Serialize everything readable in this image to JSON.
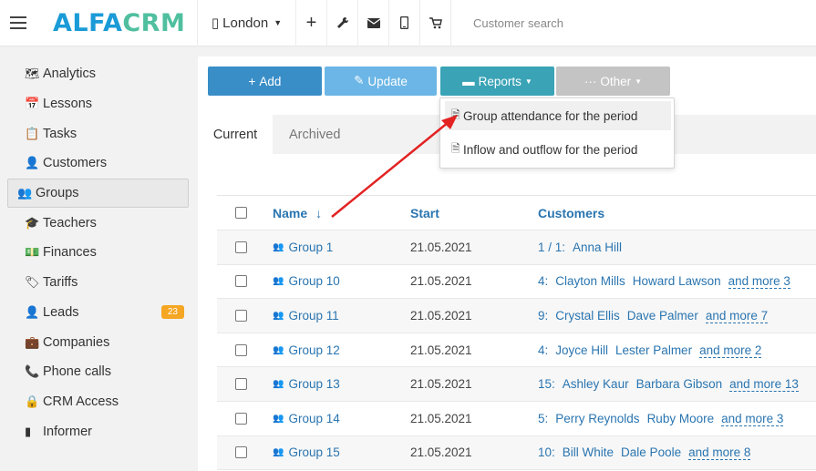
{
  "header": {
    "logo_part1": "ALFA",
    "logo_part2": "CRM",
    "city": "London",
    "search_placeholder": "Customer search",
    "icons": [
      "menu-icon",
      "tablet-icon",
      "plus-icon",
      "wrench-icon",
      "envelope-icon",
      "mobile-icon",
      "cart-icon"
    ]
  },
  "sidebar": {
    "items": [
      {
        "label": "Analytics",
        "icon": "map-icon",
        "glyph": "🗺"
      },
      {
        "label": "Lessons",
        "icon": "calendar-icon",
        "glyph": "📅"
      },
      {
        "label": "Tasks",
        "icon": "clipboard-icon",
        "glyph": "📋"
      },
      {
        "label": "Customers",
        "icon": "user-icon",
        "glyph": "👤"
      },
      {
        "label": "Groups",
        "icon": "users-icon",
        "glyph": "👥"
      },
      {
        "label": "Teachers",
        "icon": "graduation-cap-icon",
        "glyph": "🎓"
      },
      {
        "label": "Finances",
        "icon": "money-icon",
        "glyph": "💵"
      },
      {
        "label": "Tariffs",
        "icon": "tag-icon",
        "glyph": "🏷"
      },
      {
        "label": "Leads",
        "icon": "user-plus-icon",
        "glyph": "👤",
        "badge": "23"
      },
      {
        "label": "Companies",
        "icon": "briefcase-icon",
        "glyph": "💼"
      },
      {
        "label": "Phone calls",
        "icon": "phone-icon",
        "glyph": "📞"
      },
      {
        "label": "CRM Access",
        "icon": "lock-icon",
        "glyph": "🔒"
      },
      {
        "label": "Informer",
        "icon": "tablet-icon",
        "glyph": "▮"
      }
    ],
    "active": "Groups"
  },
  "toolbar": {
    "add_label": "Add",
    "update_label": "Update",
    "reports_label": "Reports",
    "other_label": "Other"
  },
  "dropdown": {
    "items": [
      "Group attendance for the period",
      "Inflow and outflow for the period"
    ]
  },
  "tabs": {
    "current": "Current",
    "archived": "Archived"
  },
  "table": {
    "headers": {
      "name": "Name",
      "start": "Start",
      "customers": "Customers"
    },
    "sort_indicator": "↓",
    "rows": [
      {
        "name": "Group 1",
        "start": "21.05.2021",
        "count": "1 / 1:",
        "people": [
          "Anna Hill"
        ],
        "more": ""
      },
      {
        "name": "Group 10",
        "start": "21.05.2021",
        "count": "4:",
        "people": [
          "Clayton Mills",
          "Howard Lawson"
        ],
        "more": "and more 3"
      },
      {
        "name": "Group 11",
        "start": "21.05.2021",
        "count": "9:",
        "people": [
          "Crystal Ellis",
          "Dave Palmer"
        ],
        "more": "and more 7"
      },
      {
        "name": "Group 12",
        "start": "21.05.2021",
        "count": "4:",
        "people": [
          "Joyce Hill",
          "Lester Palmer"
        ],
        "more": "and more 2"
      },
      {
        "name": "Group 13",
        "start": "21.05.2021",
        "count": "15:",
        "people": [
          "Ashley Kaur",
          "Barbara Gibson"
        ],
        "more": "and more 13"
      },
      {
        "name": "Group 14",
        "start": "21.05.2021",
        "count": "5:",
        "people": [
          "Perry Reynolds",
          "Ruby Moore"
        ],
        "more": "and more 3"
      },
      {
        "name": "Group 15",
        "start": "21.05.2021",
        "count": "10:",
        "people": [
          "Bill White",
          "Dale Poole"
        ],
        "more": "and more 8"
      }
    ]
  },
  "annotation": {
    "arrow_color": "#e32222"
  }
}
